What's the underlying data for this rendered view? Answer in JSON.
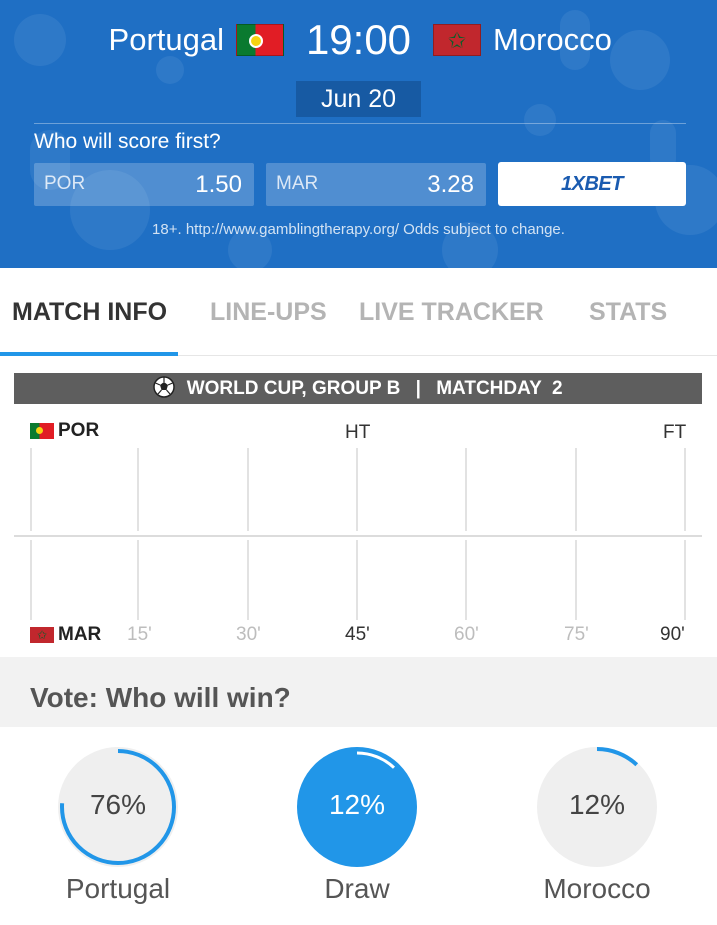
{
  "header": {
    "home_team": "Portugal",
    "away_team": "Morocco",
    "kickoff_time": "19:00",
    "date": "Jun 20",
    "question": "Who will score first?",
    "odds": [
      {
        "code": "POR",
        "value": "1.50"
      },
      {
        "code": "MAR",
        "value": "3.28"
      }
    ],
    "bookmaker": "1XBET",
    "disclaimer": "18+. http://www.gamblingtherapy.org/ Odds subject to change."
  },
  "tabs": [
    {
      "label": "MATCH INFO",
      "active": true
    },
    {
      "label": "LINE-UPS",
      "active": false
    },
    {
      "label": "LIVE TRACKER",
      "active": false
    },
    {
      "label": "STATS",
      "active": false
    }
  ],
  "match_info": {
    "competition": "WORLD CUP, GROUP B",
    "separator": "|",
    "matchday": "MATCHDAY  2",
    "home_code": "POR",
    "away_code": "MAR",
    "half_time_label": "HT",
    "full_time_label": "FT",
    "minute_ticks": [
      "15'",
      "30'",
      "45'",
      "60'",
      "75'",
      "90'"
    ]
  },
  "vote": {
    "title": "Vote: Who will win?",
    "options": [
      {
        "name": "Portugal",
        "percent": "76%",
        "fraction": 0.76,
        "selected": false
      },
      {
        "name": "Draw",
        "percent": "12%",
        "fraction": 0.12,
        "selected": true
      },
      {
        "name": "Morocco",
        "percent": "12%",
        "fraction": 0.12,
        "selected": false
      }
    ]
  },
  "colors": {
    "header_blue": "#1f6fc4",
    "accent": "#2196e8",
    "group_bar": "#5e5e5e"
  }
}
